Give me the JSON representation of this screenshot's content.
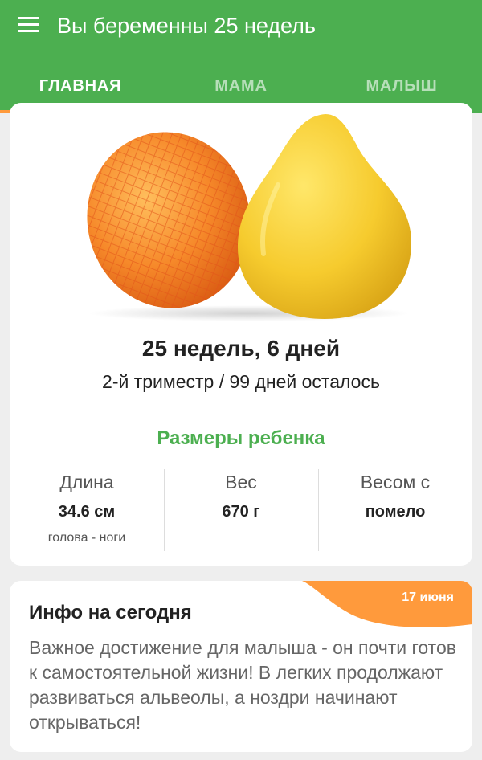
{
  "appbar": {
    "title": "Вы беременны 25 недель",
    "menu_icon": "hamburger-menu-icon",
    "color": "#4caf50"
  },
  "tabs": [
    {
      "label": "ГЛАВНАЯ",
      "active": true
    },
    {
      "label": "МАМА",
      "active": false
    },
    {
      "label": "МАЛЫШ",
      "active": false
    }
  ],
  "accent_color": "#ff9a3c",
  "summary": {
    "fruit_image": "pomelo-fruit-image",
    "weeks": "25 недель, 6 дней",
    "trimester": "2-й триместр / 99 дней осталось"
  },
  "sizes": {
    "title": "Размеры ребенка",
    "length": {
      "label": "Длина",
      "value": "34.6 см",
      "note": "голова - ноги"
    },
    "weight": {
      "label": "Вес",
      "value": "670 г"
    },
    "comparison": {
      "label": "Весом с",
      "value": "помело"
    }
  },
  "info": {
    "date": "17 июня",
    "title": "Инфо на сегодня",
    "body": "Важное достижение для малыша - он почти готов к самостоятельной жизни! В легких продолжают развиваться альвеолы, а ноздри начинают открываться!"
  }
}
